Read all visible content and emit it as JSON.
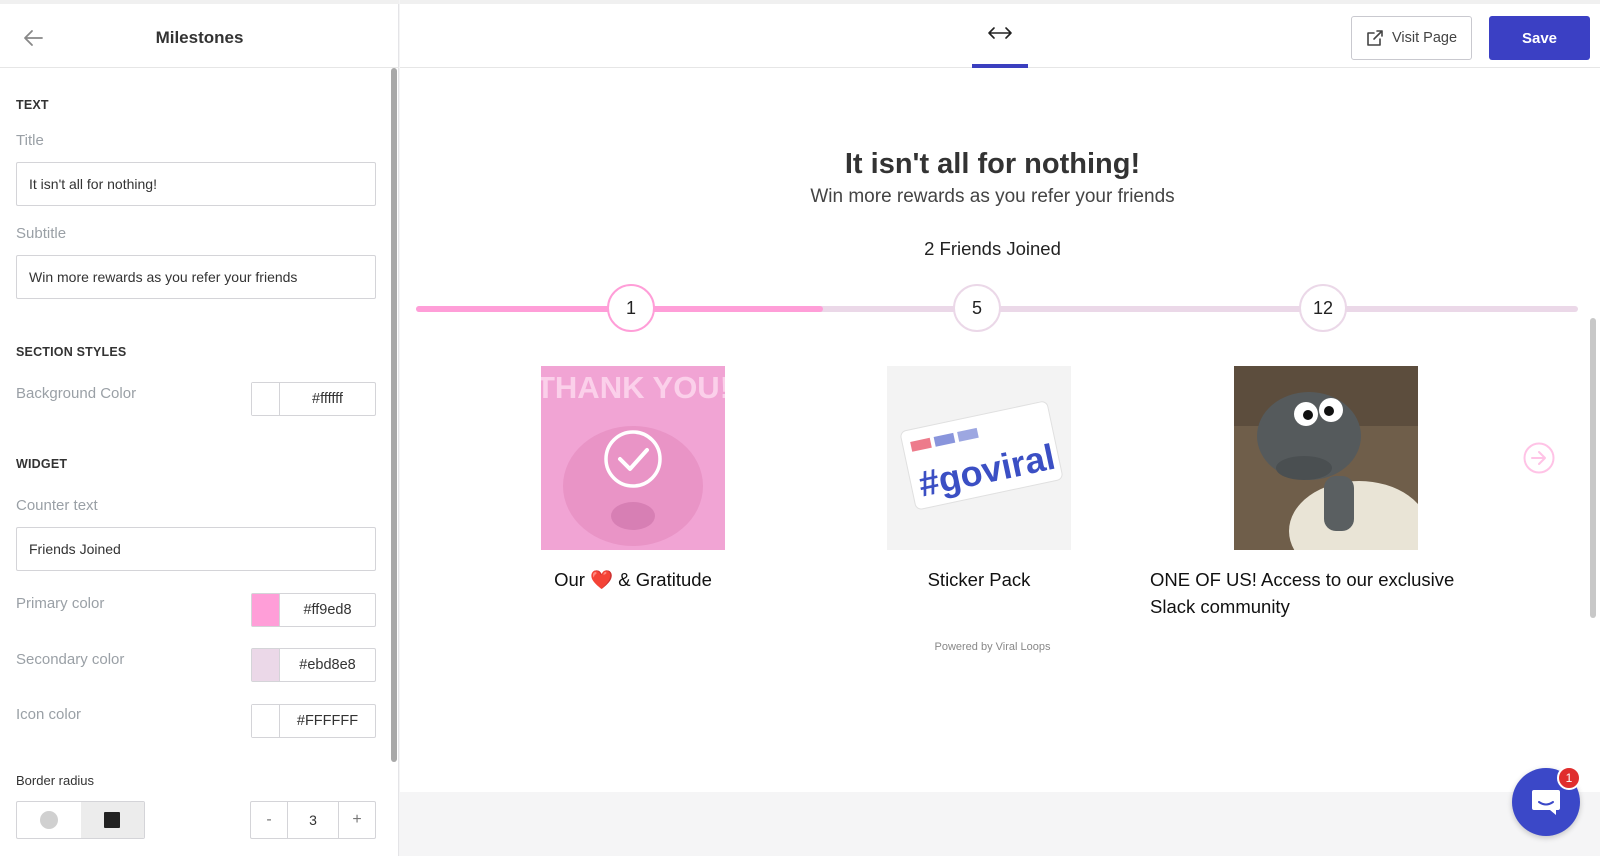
{
  "sidebar": {
    "title": "Milestones",
    "text_section": {
      "heading": "TEXT",
      "title_label": "Title",
      "title_value": "It isn't all for nothing!",
      "subtitle_label": "Subtitle",
      "subtitle_value": "Win more rewards as you refer your friends"
    },
    "section_styles": {
      "heading": "SECTION STYLES",
      "bg_label": "Background Color",
      "bg_value": "#ffffff"
    },
    "widget": {
      "heading": "WIDGET",
      "counter_label": "Counter text",
      "counter_value": "Friends Joined",
      "primary_label": "Primary color",
      "primary_value": "#ff9ed8",
      "secondary_label": "Secondary color",
      "secondary_value": "#ebd8e8",
      "icon_label": "Icon color",
      "icon_value": "#FFFFFF",
      "radius_label": "Border radius",
      "radius_minus": "-",
      "radius_value": "3",
      "radius_plus": "+"
    }
  },
  "toolbar": {
    "visit_label": "Visit Page",
    "save_label": "Save"
  },
  "preview": {
    "title": "It isn't all for nothing!",
    "subtitle": "Win more rewards as you refer your friends",
    "counter": "2 Friends Joined",
    "progress_fraction": 0.35,
    "milestones": [
      {
        "count": "1",
        "reward": "Our ❤️  & Gratitude",
        "unlocked": true,
        "image_text": "THANK YOU!"
      },
      {
        "count": "5",
        "reward": "Sticker Pack",
        "unlocked": false,
        "image_text": "#goviral"
      },
      {
        "count": "12",
        "reward": "ONE OF US! Access to our exclusive Slack community",
        "unlocked": false
      }
    ],
    "powered_by": "Powered by Viral Loops"
  },
  "chat": {
    "badge_count": "1"
  },
  "colors": {
    "accent": "#3b40c4",
    "primary": "#ff9ed8",
    "secondary": "#ebd8e8"
  }
}
